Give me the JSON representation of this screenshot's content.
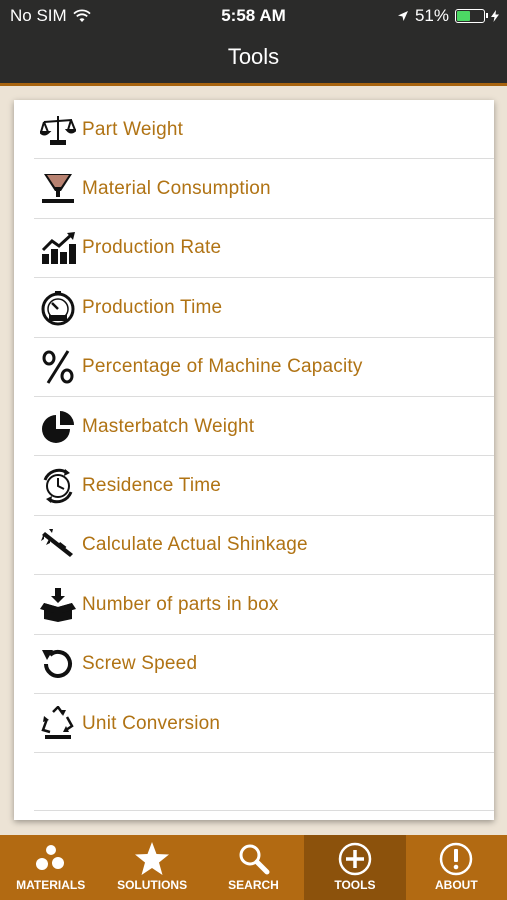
{
  "status_bar": {
    "carrier": "No SIM",
    "time": "5:58 AM",
    "battery_percent": "51%",
    "battery_level": 0.51
  },
  "header": {
    "title": "Tools"
  },
  "tools": [
    {
      "label": "Part Weight",
      "icon": "scale-icon"
    },
    {
      "label": "Material Consumption",
      "icon": "hopper-icon"
    },
    {
      "label": "Production Rate",
      "icon": "bar-chart-icon"
    },
    {
      "label": "Production Time",
      "icon": "stopwatch-icon"
    },
    {
      "label": "Percentage of Machine Capacity",
      "icon": "percent-icon"
    },
    {
      "label": "Masterbatch Weight",
      "icon": "pie-chart-icon"
    },
    {
      "label": "Residence Time",
      "icon": "cycle-clock-icon"
    },
    {
      "label": "Calculate Actual Shinkage",
      "icon": "caliper-icon"
    },
    {
      "label": "Number of parts in box",
      "icon": "box-icon"
    },
    {
      "label": "Screw Speed",
      "icon": "rotate-icon"
    },
    {
      "label": "Unit Conversion",
      "icon": "recycle-icon"
    }
  ],
  "tab_bar": {
    "tabs": [
      {
        "label": "MATERIALS",
        "icon": "pellets-icon"
      },
      {
        "label": "SOLUTIONS",
        "icon": "star-icon"
      },
      {
        "label": "SEARCH",
        "icon": "search-icon"
      },
      {
        "label": "TOOLS",
        "icon": "plus-circle-icon"
      },
      {
        "label": "ABOUT",
        "icon": "exclamation-circle-icon"
      }
    ],
    "active": "TOOLS"
  }
}
